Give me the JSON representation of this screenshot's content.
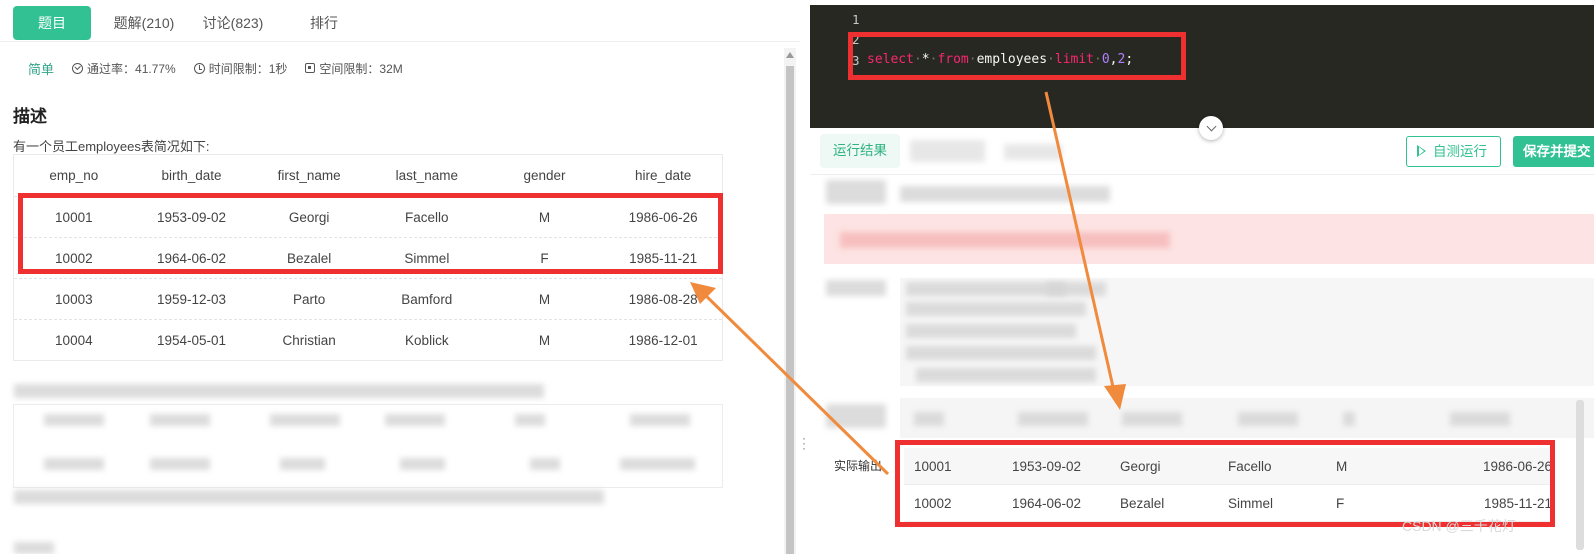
{
  "tabs": [
    {
      "label": "题目"
    },
    {
      "label": "题解(210)"
    },
    {
      "label": "讨论(823)"
    },
    {
      "label": "排行"
    }
  ],
  "meta": {
    "level": "简单",
    "pass_rate": "通过率：41.77%",
    "time_limit": "时间限制：1秒",
    "space_limit": "空间限制：32M"
  },
  "description": {
    "heading": "描述",
    "text": "有一个员工employees表简况如下:"
  },
  "employees_table": {
    "columns": [
      "emp_no",
      "birth_date",
      "first_name",
      "last_name",
      "gender",
      "hire_date"
    ],
    "rows": [
      [
        "10001",
        "1953-09-02",
        "Georgi",
        "Facello",
        "M",
        "1986-06-26"
      ],
      [
        "10002",
        "1964-06-02",
        "Bezalel",
        "Simmel",
        "F",
        "1985-11-21"
      ],
      [
        "10003",
        "1959-12-03",
        "Parto",
        "Bamford",
        "M",
        "1986-08-28"
      ],
      [
        "10004",
        "1954-05-01",
        "Christian",
        "Koblick",
        "M",
        "1986-12-01"
      ]
    ]
  },
  "editor": {
    "line_numbers": [
      "1",
      "2",
      "3"
    ],
    "code": {
      "kw_select": "select",
      "star": "*",
      "kw_from": "from",
      "table": "employees",
      "kw_limit": "limit",
      "num_offset": "0",
      "comma": ",",
      "num_count": "2",
      "semicolon": ";",
      "dot": "·"
    }
  },
  "result_panel": {
    "tab_label": "运行结果",
    "self_run_label": "自测运行",
    "save_label": "保存并提交",
    "actual_output_label": "实际输出",
    "actual_output_rows": [
      [
        "10001",
        "1953-09-02",
        "Georgi",
        "Facello",
        "M",
        "1986-06-26"
      ],
      [
        "10002",
        "1964-06-02",
        "Bezalel",
        "Simmel",
        "F",
        "1985-11-21"
      ]
    ]
  },
  "watermark": "CSDN @三千花灯",
  "colors": {
    "accent": "#32c192",
    "annotation": "#ee3130",
    "arrow": "#f08a3c",
    "editor_bg": "#272822"
  }
}
